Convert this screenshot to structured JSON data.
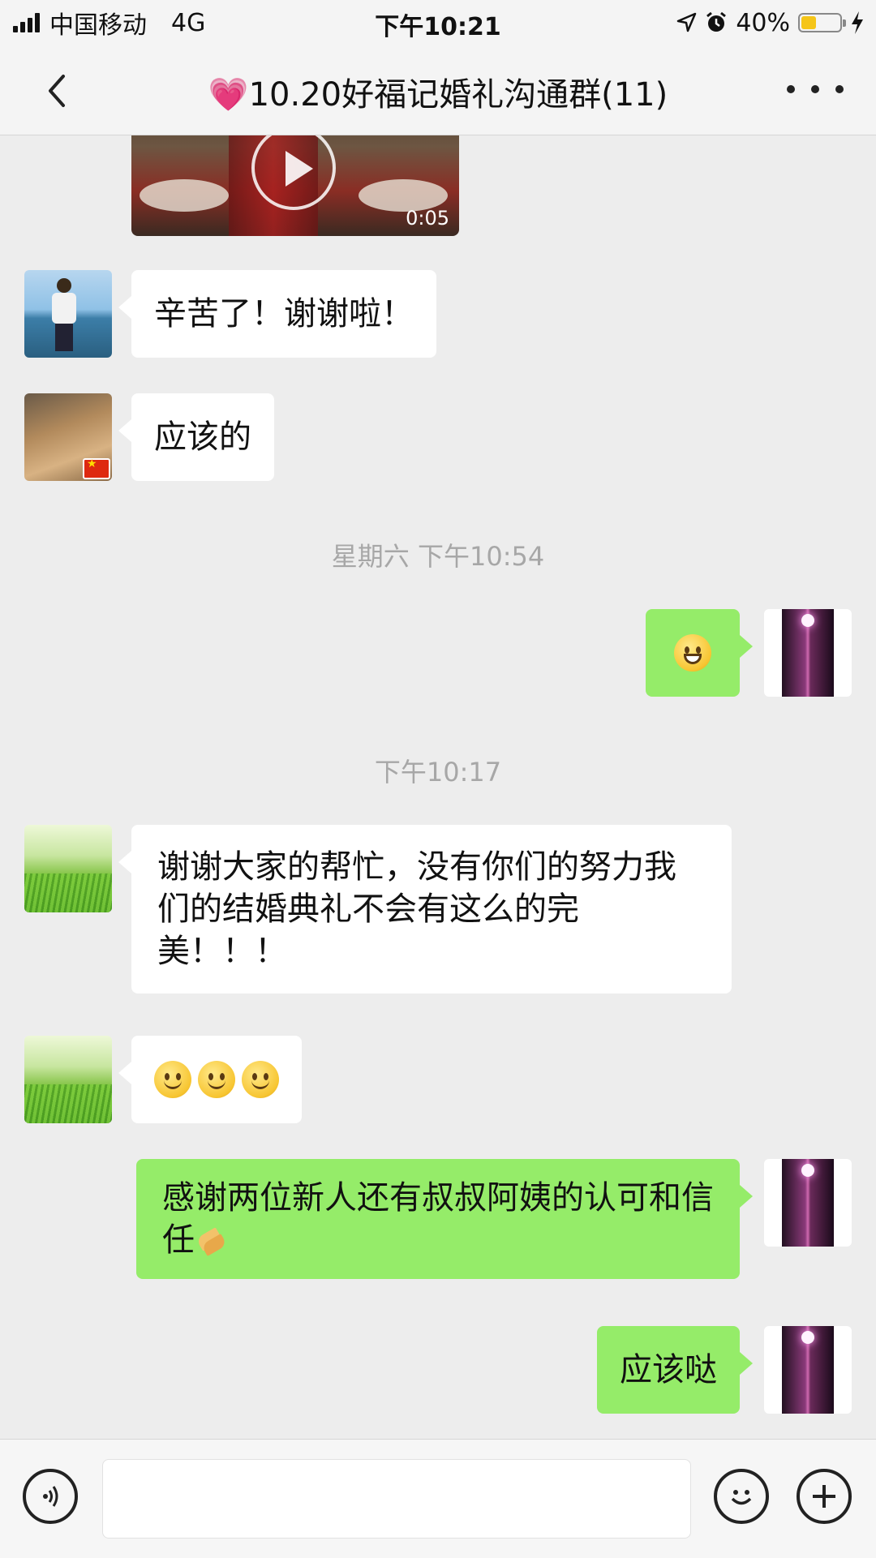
{
  "status_bar": {
    "carrier": "中国移动",
    "network": "4G",
    "time": "下午10:21",
    "battery": "40%",
    "battery_level": 0.4
  },
  "header": {
    "title": "💗10.20好福记婚礼沟通群(11)",
    "back_icon": "chevron-left-icon",
    "more_icon": "more-dots-icon"
  },
  "video_message": {
    "duration": "0:05"
  },
  "messages": [
    {
      "side": "left",
      "avatar": "beach-photo",
      "text": "辛苦了！谢谢啦！"
    },
    {
      "side": "left",
      "avatar": "tiger-photo",
      "text": "应该的"
    },
    {
      "side": "right",
      "avatar": "self-photo",
      "emoji": "grin"
    },
    {
      "side": "left",
      "avatar": "grass-photo",
      "text": "谢谢大家的帮忙，没有你们的努力我们的结婚典礼不会有这么的完美！！！"
    },
    {
      "side": "left",
      "avatar": "grass-photo",
      "emoji": "smile x3"
    },
    {
      "side": "right",
      "avatar": "self-photo",
      "text": "感谢两位新人还有叔叔阿姨的认可和信任",
      "emoji": "clap"
    },
    {
      "side": "right",
      "avatar": "self-photo",
      "text": "应该哒"
    }
  ],
  "timestamps": [
    "星期六 下午10:54",
    "下午10:17"
  ],
  "input_bar": {
    "voice_icon": "voice-icon",
    "emoji_icon": "emoji-icon",
    "plus_icon": "plus-icon",
    "text": ""
  },
  "colors": {
    "background": "#ededed",
    "bubble_self": "#95ec69",
    "bubble_other": "#ffffff",
    "timestamp": "#a7a7a7",
    "battery": "#f5c518"
  }
}
